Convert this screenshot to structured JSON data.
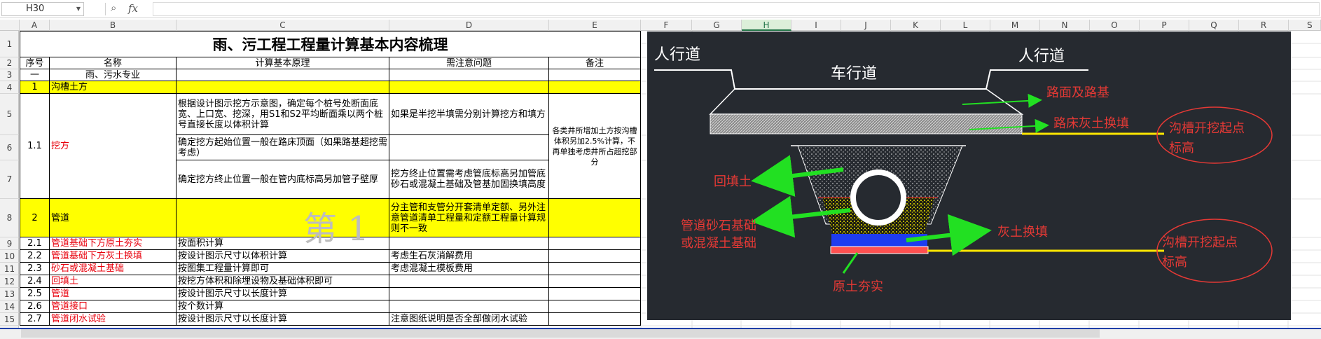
{
  "formula_bar": {
    "cell_ref": "H30",
    "zoom_icon": "search-icon",
    "fx": "fx",
    "value": ""
  },
  "columns": [
    "A",
    "B",
    "C",
    "D",
    "E",
    "F",
    "G",
    "H",
    "I",
    "J",
    "K",
    "L",
    "M",
    "N",
    "O",
    "P",
    "Q",
    "R",
    "S"
  ],
  "rows": [
    "1",
    "2",
    "3",
    "4",
    "5",
    "6",
    "7",
    "8",
    "9",
    "10",
    "11",
    "12",
    "13",
    "14",
    "15",
    "16"
  ],
  "sheet": {
    "title": "雨、污工程工程量计算基本内容梳理",
    "headers": {
      "seq": "序号",
      "name": "名称",
      "principle": "计算基本原理",
      "notes": "需注意问题",
      "remarks": "备注"
    },
    "row3": {
      "seq": "一",
      "name": "雨、污水专业"
    },
    "row4": {
      "seq": "1",
      "name": "沟槽土方"
    },
    "row5": {
      "principle": "根据设计图示挖方示意图，确定每个桩号处断面底宽、上口宽、挖深，用S1和S2平均断面乘以两个桩号直接长度以体积计算",
      "notes": "如果是半挖半填需分别计算挖方和填方"
    },
    "row6": {
      "seq": "1.1",
      "name": "挖方",
      "principle": "确定挖方起始位置一般在路床顶面（如果路基超挖需考虑）"
    },
    "row7": {
      "principle": "确定挖方终止位置一般在管内底标高另加管子壁厚",
      "notes": "挖方终止位置需考虑管底标高另加管底砂石或混凝土基础及管基加固换填高度"
    },
    "remark_5_7": "各类井所增加土方按沟槽体积另加2.5%计算，不再单独考虑井所占超挖部分",
    "row8": {
      "seq": "2",
      "name": "管道",
      "notes": "分主管和支管分开套清单定额、另外注意管道清单工程量和定额工程量计算规则不一致"
    },
    "items": [
      {
        "seq": "2.1",
        "name": "管道基础下方原土夯实",
        "principle": "按面积计算",
        "notes": ""
      },
      {
        "seq": "2.2",
        "name": "管道基础下方灰土换填",
        "principle": "按设计图示尺寸以体积计算",
        "notes": "考虑生石灰消解费用"
      },
      {
        "seq": "2.3",
        "name": "砂石或混凝土基础",
        "principle": "按图集工程量计算即可",
        "notes": "考虑混凝土模板费用"
      },
      {
        "seq": "2.4",
        "name": "回填土",
        "principle": "按挖方体积和除埋设物及基础体积即可",
        "notes": ""
      },
      {
        "seq": "2.5",
        "name": "管道",
        "principle": "按设计图示尺寸以长度计算",
        "notes": ""
      },
      {
        "seq": "2.6",
        "name": "管道接口",
        "principle": "按个数计算",
        "notes": ""
      },
      {
        "seq": "2.7",
        "name": "管道闭水试验",
        "principle": "按设计图示尺寸以长度计算",
        "notes": "注意图纸说明是否全部做闭水试验"
      }
    ],
    "watermark": "第 1"
  },
  "diagram": {
    "labels": {
      "sidewalk_left": "人行道",
      "sidewalk_right": "人行道",
      "carriageway": "车行道",
      "pavement": "路面及路基",
      "subgrade_fill": "路床灰土换填",
      "backfill": "回填土",
      "pipe_base_1": "管道砂石基础",
      "pipe_base_2": "或混凝土基础",
      "lime_fill": "灰土换填",
      "compacted": "原土夯实",
      "trench_top_1": "沟槽开挖起点",
      "trench_top_2": "标高",
      "trench_bottom_1": "沟槽开挖起点",
      "trench_bottom_2": "标高"
    },
    "colors": {
      "bg": "#262a30",
      "text": "#e53935",
      "arrow": "#22e022",
      "guide": "#ffe600",
      "outline": "#ffffff",
      "blue": "#1e3cf0",
      "red": "#ff5050"
    }
  },
  "colors": {
    "highlight": "#ffff00",
    "red_text": "#e8000c",
    "selected_col": "#217346"
  }
}
